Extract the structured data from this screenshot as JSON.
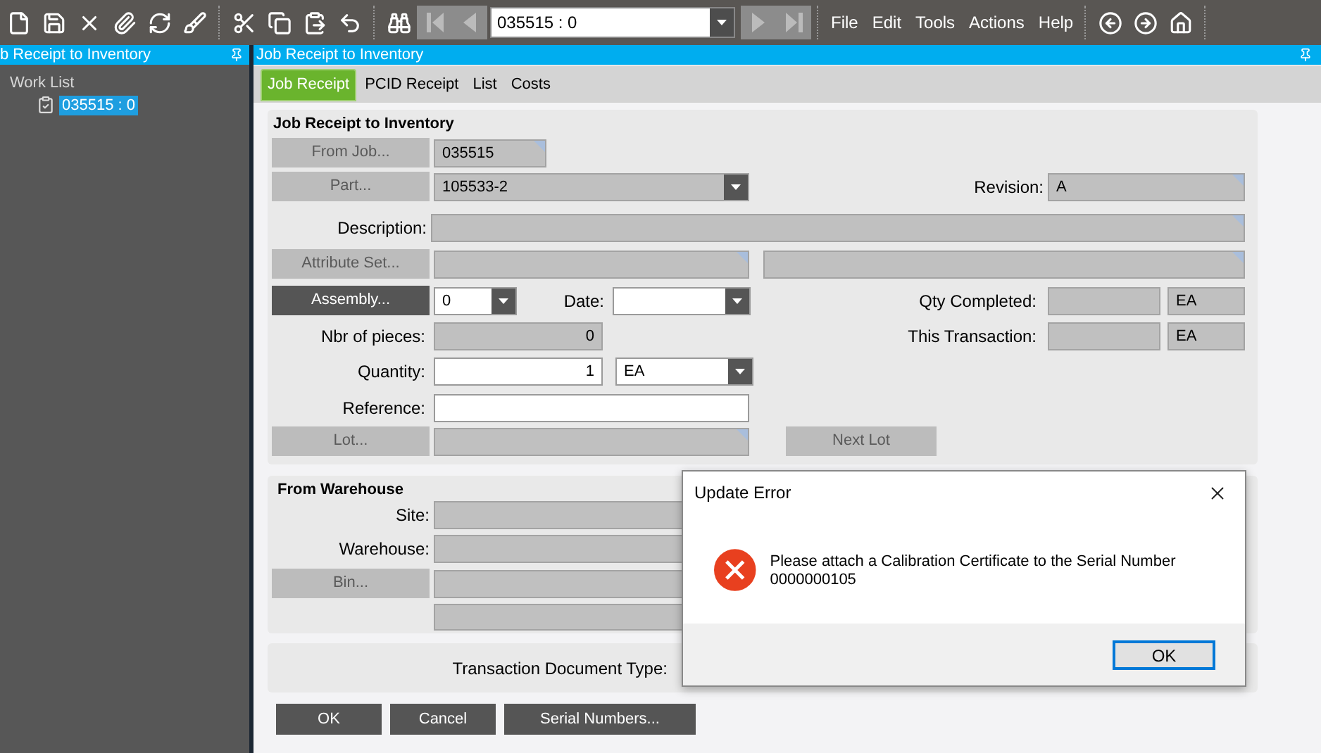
{
  "toolbar": {
    "record": "035515 : 0",
    "menus": [
      "File",
      "Edit",
      "Tools",
      "Actions",
      "Help"
    ]
  },
  "left_panel": {
    "title": "b Receipt to Inventory",
    "work_list": {
      "label": "Work List",
      "children": [
        {
          "label": "035515 : 0",
          "selected": true
        }
      ]
    }
  },
  "main": {
    "title": "Job Receipt to Inventory",
    "tabs": [
      {
        "label": "Job Receipt",
        "selected": true
      },
      {
        "label": "PCID Receipt",
        "selected": false
      },
      {
        "label": "List",
        "selected": false
      },
      {
        "label": "Costs",
        "selected": false
      }
    ],
    "receipt": {
      "title": "Job Receipt to Inventory",
      "from_job": {
        "button": {
          "label": "From Job...",
          "disabled": true
        },
        "field": {
          "value": "035515",
          "disabled": true,
          "marked": true
        }
      },
      "part": {
        "button": {
          "label": "Part...",
          "disabled": true
        },
        "field": {
          "value": "105533-2",
          "disabled": true
        }
      },
      "revision": {
        "label": "Revision:",
        "field": {
          "value": "A",
          "disabled": true,
          "marked": true
        }
      },
      "description": {
        "label": "Description:",
        "field": {
          "disabled": true,
          "marked": true
        }
      },
      "attribute_set": {
        "button": {
          "label": "Attribute Set...",
          "disabled": true
        },
        "field": {
          "disabled": true,
          "marked": true
        },
        "field_2": {
          "disabled": true,
          "marked": true
        }
      },
      "assembly": {
        "button": {
          "label": "Assembly...",
          "disabled": false
        },
        "field": {
          "value": "0",
          "disabled": false
        }
      },
      "date": {
        "label": "Date:",
        "field": {
          "disabled": false
        }
      },
      "qty_completed": {
        "label": "Qty Completed:",
        "field": {
          "disabled": true
        },
        "uom": {
          "value": "EA",
          "disabled": true
        }
      },
      "nbr_of_pieces": {
        "label": "Nbr of pieces:",
        "field": {
          "value": "0",
          "disabled": true
        }
      },
      "this_transaction": {
        "label": "This Transaction:",
        "field": {
          "disabled": true
        },
        "uom": {
          "value": "EA",
          "disabled": true
        }
      },
      "quantity": {
        "label": "Quantity:",
        "field": {
          "value": "1",
          "disabled": false
        },
        "uom": {
          "value": "EA",
          "disabled": false
        }
      },
      "reference": {
        "label": "Reference:",
        "field": {
          "disabled": false
        }
      },
      "lot": {
        "button": {
          "label": "Lot...",
          "disabled": true
        },
        "field": {
          "disabled": true,
          "marked": true
        }
      },
      "next_lot": {
        "label": "Next Lot",
        "disabled": true
      }
    },
    "from_warehouse": {
      "title": "From Warehouse",
      "site": {
        "label": "Site:"
      },
      "warehouse": {
        "label": "Warehouse:"
      },
      "bin": {
        "label": "Bin...",
        "disabled": true
      }
    },
    "transaction_document_type": {
      "label": "Transaction Document Type:"
    },
    "buttons": [
      "OK",
      "Cancel",
      "Serial Numbers..."
    ]
  },
  "dialog": {
    "title": "Update Error",
    "message": "Please attach a Calibration Certificate to the Serial Number 0000000105",
    "ok": "OK"
  }
}
